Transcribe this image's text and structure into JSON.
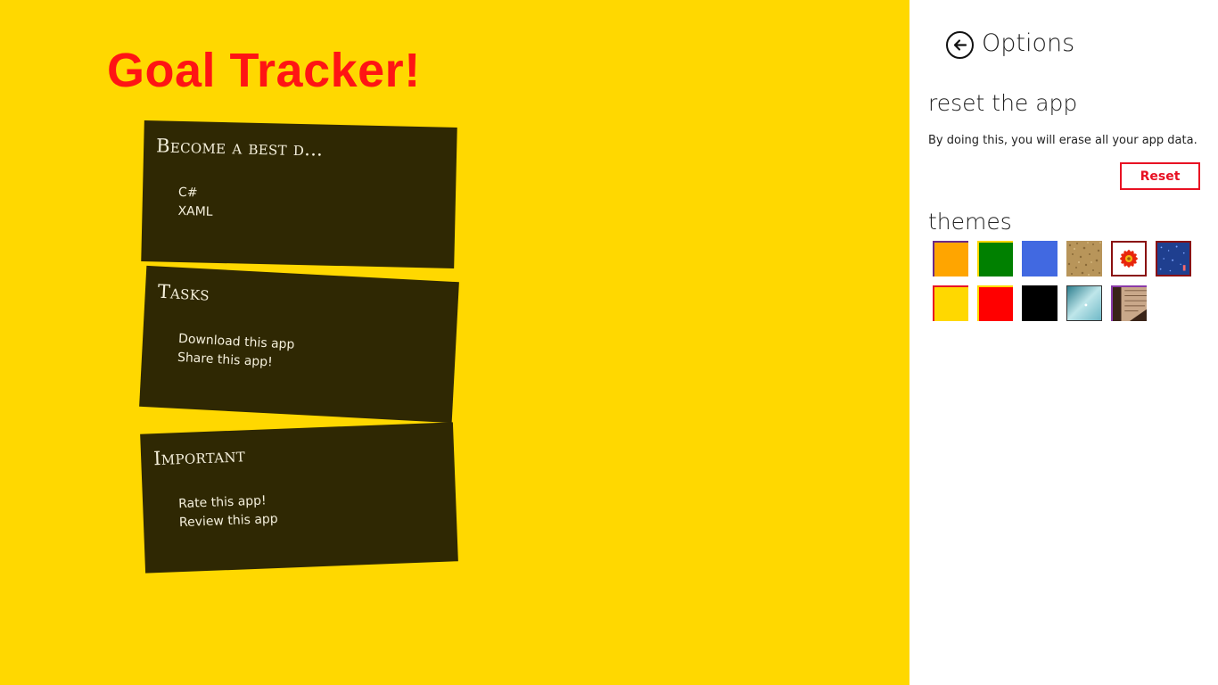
{
  "app": {
    "title": "Goal Tracker!",
    "background": "#ffd800",
    "title_color": "#ff1414",
    "card_color": "#2f2803"
  },
  "goals": [
    {
      "title": "Become a best d...",
      "items": [
        "C#",
        "XAML"
      ]
    },
    {
      "title": "Tasks",
      "items": [
        "Download this app",
        "Share this app!"
      ]
    },
    {
      "title": "Important",
      "items": [
        "Rate this app!",
        "Review this app"
      ]
    }
  ],
  "options": {
    "title": "Options",
    "back_icon": "back-arrow-circle-icon",
    "reset_heading": "reset the app",
    "reset_description": "By doing this, you will erase all your app data.",
    "reset_button": "Reset",
    "themes_heading": "themes",
    "themes": [
      {
        "name": "orange",
        "color": "#ffa500",
        "kind": "solid"
      },
      {
        "name": "green",
        "color": "#008000",
        "kind": "solid"
      },
      {
        "name": "blue",
        "color": "#4169e1",
        "kind": "solid"
      },
      {
        "name": "sand",
        "color": "#b8955a",
        "kind": "texture"
      },
      {
        "name": "flower",
        "color": "#ffffff",
        "kind": "image"
      },
      {
        "name": "blue-sparkle",
        "color": "#1f3f8f",
        "kind": "texture"
      },
      {
        "name": "yellow",
        "color": "#ffd800",
        "kind": "solid",
        "selected": true
      },
      {
        "name": "red",
        "color": "#ff0000",
        "kind": "solid"
      },
      {
        "name": "black",
        "color": "#000000",
        "kind": "solid"
      },
      {
        "name": "water",
        "color": "#9fd3dc",
        "kind": "image"
      },
      {
        "name": "books",
        "color": "#5a3a2a",
        "kind": "image"
      }
    ]
  }
}
